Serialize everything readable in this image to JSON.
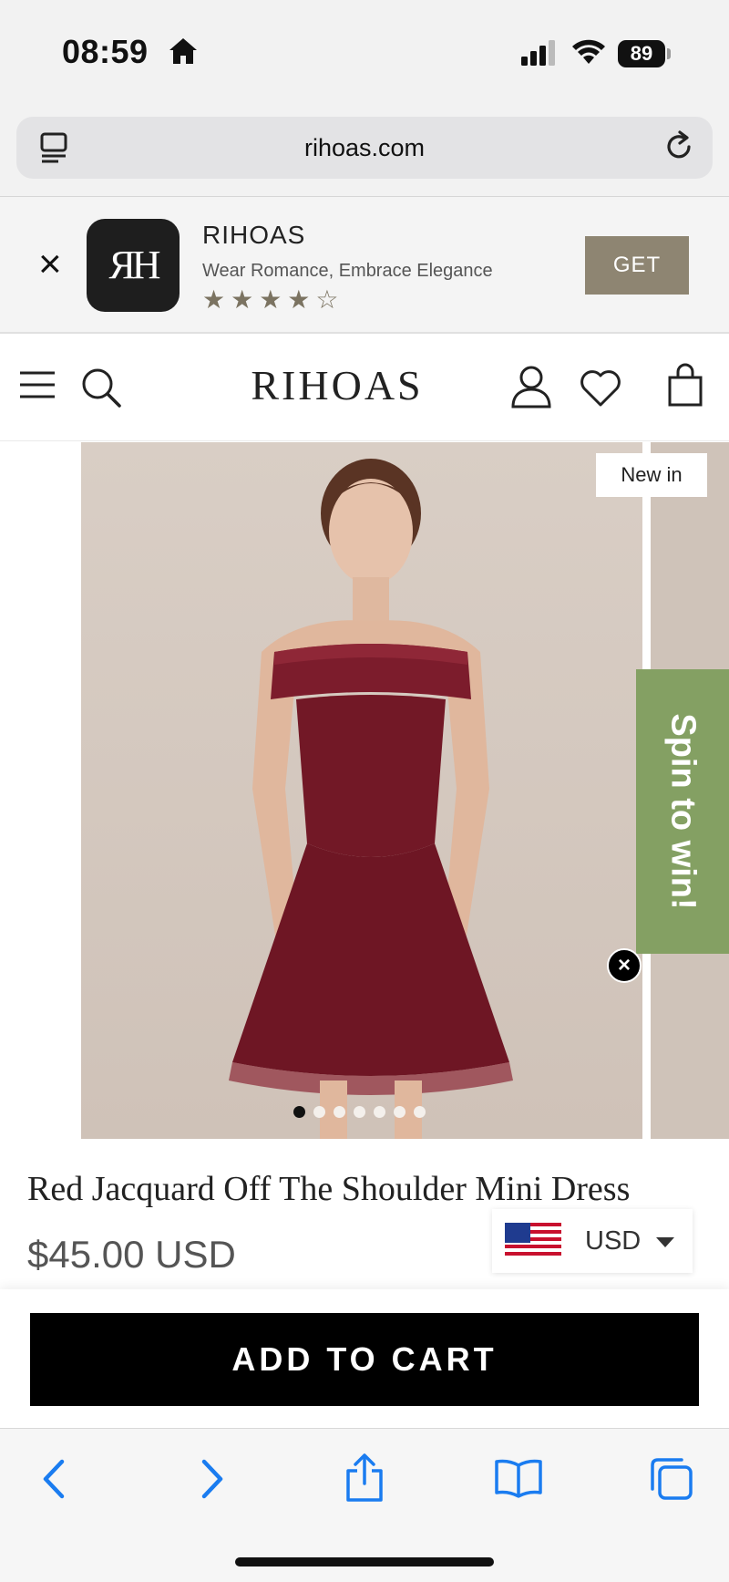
{
  "status_bar": {
    "time": "08:59",
    "battery": "89"
  },
  "browser": {
    "url": "rihoas.com"
  },
  "app_banner": {
    "logo_text": "ЯH",
    "name": "RIHOAS",
    "tagline": "Wear Romance, Embrace Elegance",
    "stars": "★★★★☆",
    "rating": 4.5,
    "get_label": "GET",
    "close_label": "×"
  },
  "header": {
    "logo": "RIHOAS"
  },
  "gallery": {
    "badge": "New in",
    "image_count": 7,
    "active_index": 0,
    "spin_label": "Spin to win!",
    "spin_close": "×"
  },
  "product": {
    "title": "Red Jacquard Off The Shoulder Mini Dress",
    "price": "$45.00 USD"
  },
  "currency": {
    "selected": "USD"
  },
  "cart": {
    "add_label": "ADD TO CART"
  },
  "colors": {
    "accent_get": "#8e8572",
    "spin_green": "#84a063",
    "dress_red": "#7a1a2a",
    "safari_blue": "#1a7cf0"
  }
}
